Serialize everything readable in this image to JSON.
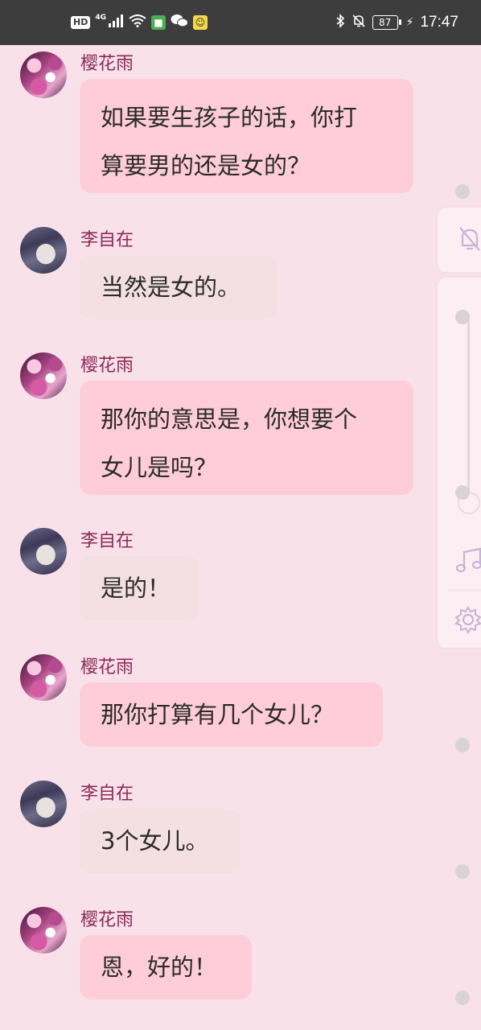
{
  "status_bar": {
    "hd": "HD",
    "network": "4G",
    "battery": "87",
    "time": "17:47",
    "icons": [
      "hd-icon",
      "signal-icon",
      "wifi-icon",
      "app-green-icon",
      "wechat-icon",
      "app-yellow-icon",
      "bluetooth-icon",
      "mute-icon",
      "battery-icon",
      "charging-icon"
    ]
  },
  "messages": [
    {
      "sender": "樱花雨",
      "lines": [
        "如果要生孩子的话，你打",
        "算要男的还是女的？"
      ]
    },
    {
      "sender": "李自在",
      "lines": [
        "当然是女的。"
      ]
    },
    {
      "sender": "樱花雨",
      "lines": [
        "那你的意思是，你想要个",
        "女儿是吗？"
      ]
    },
    {
      "sender": "李自在",
      "lines": [
        "是的！"
      ]
    },
    {
      "sender": "樱花雨",
      "lines": [
        "那你打算有几个女儿？"
      ]
    },
    {
      "sender": "李自在",
      "lines": [
        "3个女儿。"
      ]
    },
    {
      "sender": "樱花雨",
      "lines": [
        "恩，好的！"
      ]
    }
  ],
  "side_panel": {
    "icons": [
      "bell-off-icon",
      "volume-slider",
      "music-note-icon",
      "gear-icon"
    ]
  },
  "colors": {
    "background": "#f9e1ea",
    "bubble_pink": "#ffcdd9",
    "bubble_grey": "#f4e0e3",
    "name_color": "#8c2a56",
    "status_bar": "#3d3d3d"
  }
}
